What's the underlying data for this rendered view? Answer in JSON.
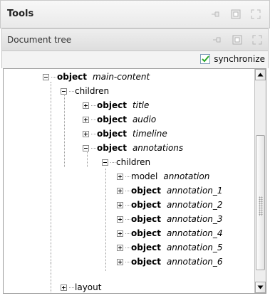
{
  "tools_panel": {
    "title": "Tools",
    "icons": [
      "pin-icon",
      "restore-icon",
      "maximize-icon"
    ]
  },
  "document_tree": {
    "title": "Document tree",
    "icons": [
      "pin-icon",
      "restore-icon",
      "maximize-icon"
    ],
    "synchronize": {
      "label": "synchronize",
      "checked": true
    }
  },
  "tree": [
    {
      "kind": "object",
      "name": "main-content",
      "expanded": true
    },
    {
      "kind": "children",
      "name": "",
      "expanded": true
    },
    {
      "kind": "object",
      "name": "title",
      "expanded": false
    },
    {
      "kind": "object",
      "name": "audio",
      "expanded": false
    },
    {
      "kind": "object",
      "name": "timeline",
      "expanded": false
    },
    {
      "kind": "object",
      "name": "annotations",
      "expanded": true
    },
    {
      "kind": "children",
      "name": "",
      "expanded": true
    },
    {
      "kind": "model",
      "name": "annotation",
      "expanded": false
    },
    {
      "kind": "object",
      "name": "annotation_1",
      "expanded": false
    },
    {
      "kind": "object",
      "name": "annotation_2",
      "expanded": false
    },
    {
      "kind": "object",
      "name": "annotation_3",
      "expanded": false
    },
    {
      "kind": "object",
      "name": "annotation_4",
      "expanded": false
    },
    {
      "kind": "object",
      "name": "annotation_5",
      "expanded": false
    },
    {
      "kind": "object",
      "name": "annotation_6",
      "expanded": false
    },
    {
      "kind": "layout",
      "name": "",
      "expanded": false
    }
  ],
  "colors": {
    "checkmark": "#2aa82a",
    "panel_border": "#c7c7c7"
  }
}
